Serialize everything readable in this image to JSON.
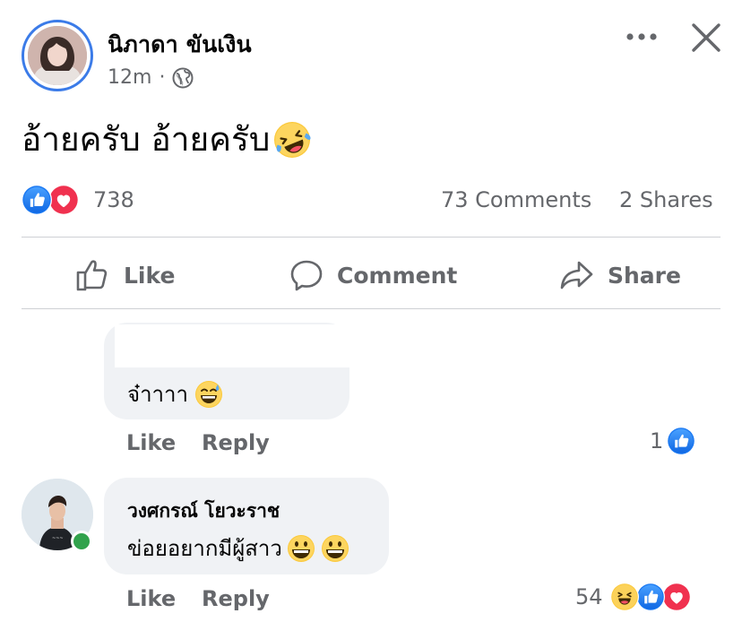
{
  "post": {
    "author": "นิภาดา ขันเงิน",
    "time": "12m",
    "separator": "·",
    "text": "อ้ายครับ อ้ายครับ",
    "reactions_count": "738",
    "comments_count": "73 Comments",
    "shares_count": "2 Shares"
  },
  "actions": {
    "like": "Like",
    "comment": "Comment",
    "share": "Share"
  },
  "comments": [
    {
      "text": "จ๋าาาา",
      "like_label": "Like",
      "reply_label": "Reply",
      "reaction_count": "1"
    },
    {
      "name": "วงศกรณ์ โยวะราช",
      "text": "ข่อยอยากมีผู้สาว",
      "like_label": "Like",
      "reply_label": "Reply",
      "reaction_count": "54"
    }
  ],
  "colors": {
    "like_blue": "#1877f2",
    "love_red": "#f33e58",
    "text_secondary": "#65676b",
    "bubble_bg": "#f0f2f5",
    "online_green": "#31a24c",
    "avatar_ring": "#3b7be8"
  },
  "icons": [
    "ellipsis-icon",
    "close-icon",
    "globe-icon",
    "thumbs-up-icon",
    "comment-icon",
    "share-icon",
    "love-reaction-icon",
    "like-reaction-icon",
    "haha-reaction-icon"
  ]
}
